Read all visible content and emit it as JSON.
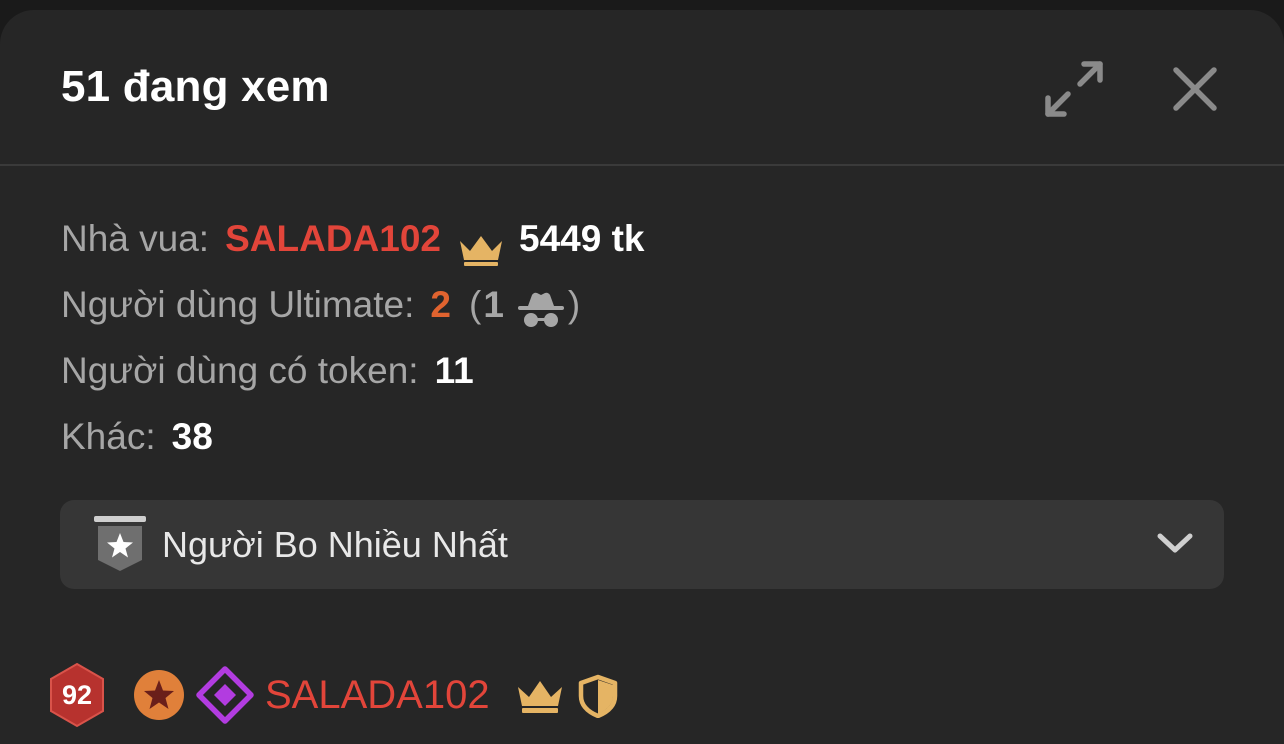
{
  "header": {
    "title": "51 đang xem",
    "expand_icon": "expand-arrows-icon",
    "close_icon": "close-icon"
  },
  "stats": {
    "king_label": "Nhà vua:",
    "king_name": "SALADA102",
    "king_tokens": "5449 tk",
    "ultimate_label": "Người dùng Ultimate:",
    "ultimate_count": "2",
    "ultimate_paren_open": "(",
    "ultimate_anonymous_count": "1",
    "ultimate_paren_close": ")",
    "token_users_label": "Người dùng có token:",
    "token_users_count": "11",
    "other_label": "Khác:",
    "other_count": "38"
  },
  "dropdown": {
    "label": "Người Bo Nhiều Nhất",
    "icon": "star-shield-badge-icon",
    "chevron": "chevron-down-icon"
  },
  "users": [
    {
      "level": "92",
      "name": "SALADA102",
      "badges": [
        "level-badge-icon",
        "star-badge-icon",
        "diamond-badge-icon",
        "crown-icon",
        "shield-icon"
      ]
    }
  ],
  "colors": {
    "background": "#262626",
    "king_red": "#e2453a",
    "ultimate_orange": "#e0632f",
    "crown_gold": "#e5b464",
    "diamond_purple": "#b23ce0",
    "level_red": "#b7322e",
    "star_orange": "#e0803a",
    "muted_text": "#a6a6a6",
    "dropdown_bg": "#363636"
  }
}
